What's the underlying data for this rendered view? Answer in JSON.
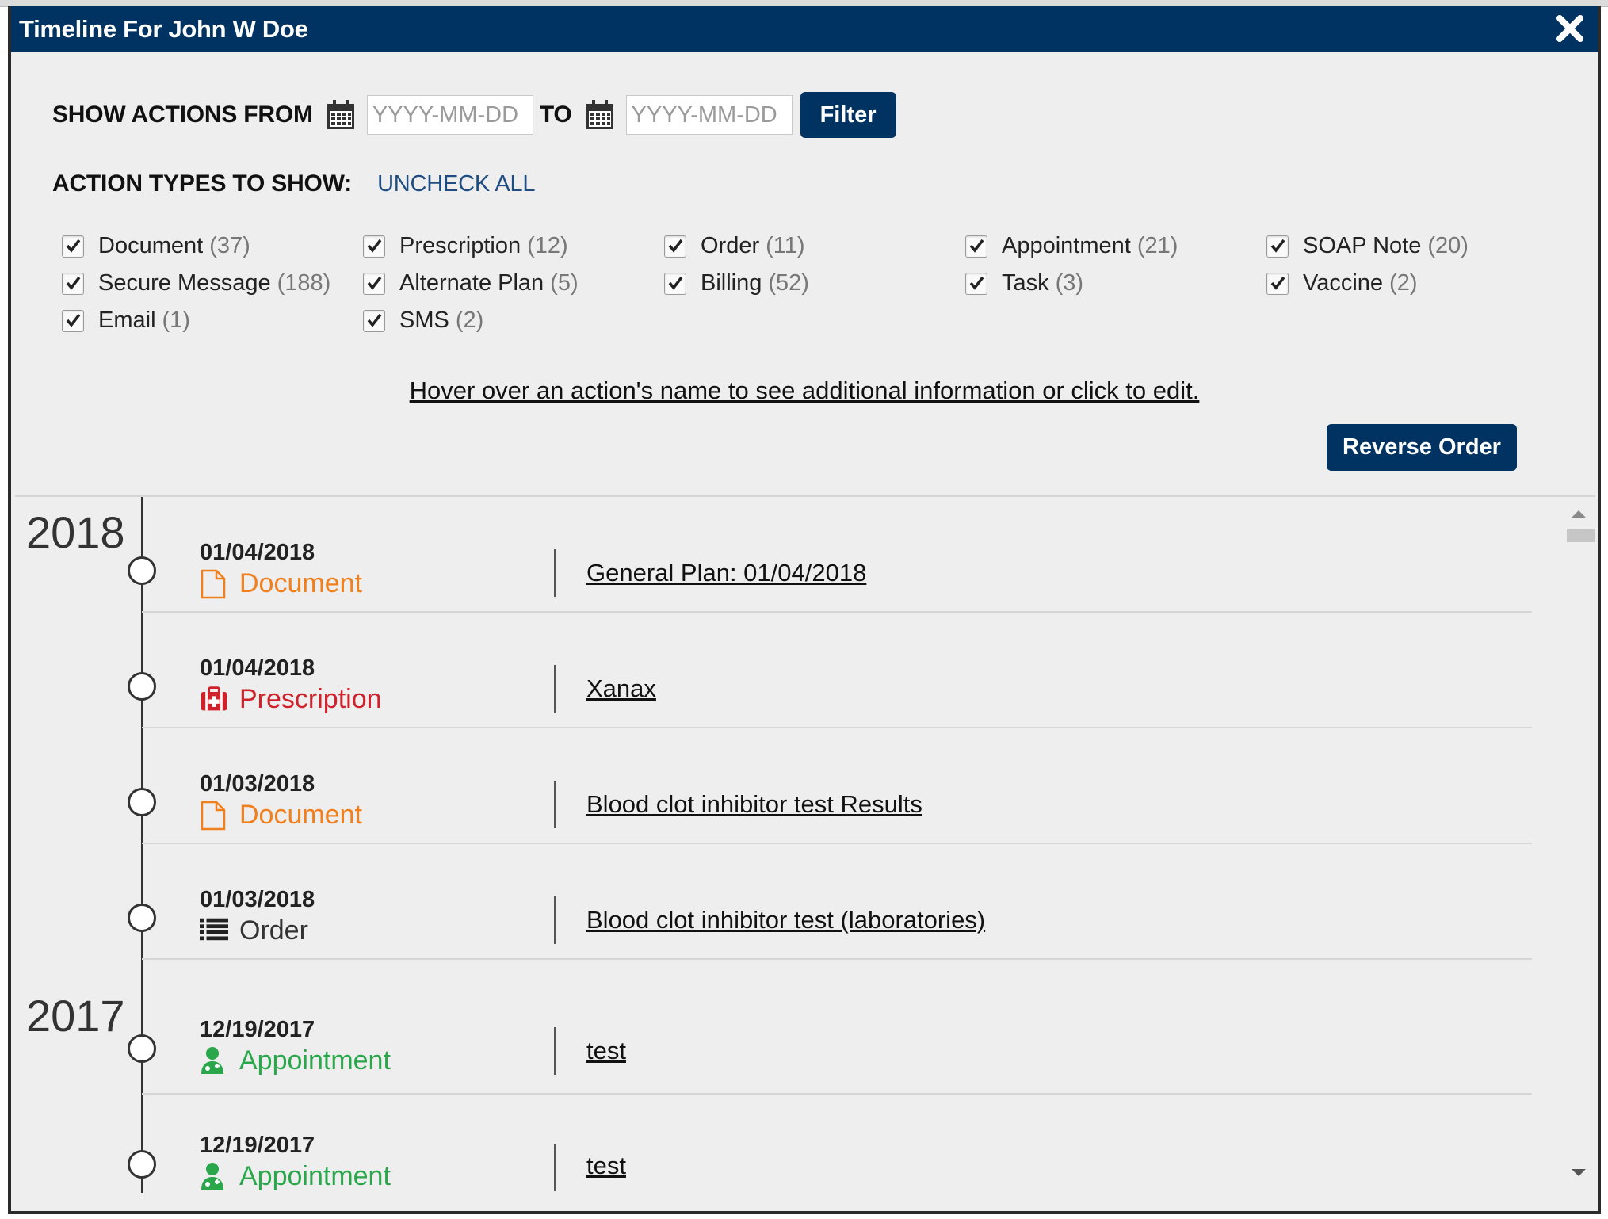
{
  "window": {
    "title": "Timeline For John W Doe",
    "close_icon": "close-x-icon"
  },
  "filter": {
    "from_label": "SHOW ACTIONS FROM",
    "to_label": "TO",
    "from_placeholder": "YYYY-MM-DD",
    "to_placeholder": "YYYY-MM-DD",
    "calendar_icon": "calendar-icon",
    "button_label": "Filter"
  },
  "action_types": {
    "heading": "ACTION TYPES TO SHOW:",
    "uncheck_all": "UNCHECK ALL",
    "items": [
      {
        "label": "Document",
        "count": "(37)",
        "checked": true
      },
      {
        "label": "Prescription",
        "count": "(12)",
        "checked": true
      },
      {
        "label": "Order",
        "count": "(11)",
        "checked": true
      },
      {
        "label": "Appointment",
        "count": "(21)",
        "checked": true
      },
      {
        "label": "SOAP Note",
        "count": "(20)",
        "checked": true
      },
      {
        "label": "Secure Message",
        "count": "(188)",
        "checked": true
      },
      {
        "label": "Alternate Plan",
        "count": "(5)",
        "checked": true
      },
      {
        "label": "Billing",
        "count": "(52)",
        "checked": true
      },
      {
        "label": "Task",
        "count": "(3)",
        "checked": true
      },
      {
        "label": "Vaccine",
        "count": "(2)",
        "checked": true
      },
      {
        "label": "Email",
        "count": "(1)",
        "checked": true
      },
      {
        "label": "SMS",
        "count": "(2)",
        "checked": true
      }
    ]
  },
  "hint": "Hover over an action's name to see additional information or click to edit.",
  "reverse_button": "Reverse Order",
  "colors": {
    "header": "#003262",
    "document": "#f07f1e",
    "prescription": "#d0222b",
    "order": "#333333",
    "appointment": "#2aa64b"
  },
  "timeline": {
    "years": [
      "2018",
      "2017"
    ],
    "entries": [
      {
        "date": "01/04/2018",
        "type": "Document",
        "icon": "document-icon",
        "title": "General Plan: 01/04/2018"
      },
      {
        "date": "01/04/2018",
        "type": "Prescription",
        "icon": "medkit-icon",
        "title": "Xanax"
      },
      {
        "date": "01/03/2018",
        "type": "Document",
        "icon": "document-icon",
        "title": "Blood clot inhibitor test Results"
      },
      {
        "date": "01/03/2018",
        "type": "Order",
        "icon": "list-icon",
        "title": "Blood clot inhibitor test (laboratories)"
      },
      {
        "date": "12/19/2017",
        "type": "Appointment",
        "icon": "doctor-icon",
        "title": "test"
      },
      {
        "date": "12/19/2017",
        "type": "Appointment",
        "icon": "doctor-icon",
        "title": "test"
      }
    ]
  }
}
